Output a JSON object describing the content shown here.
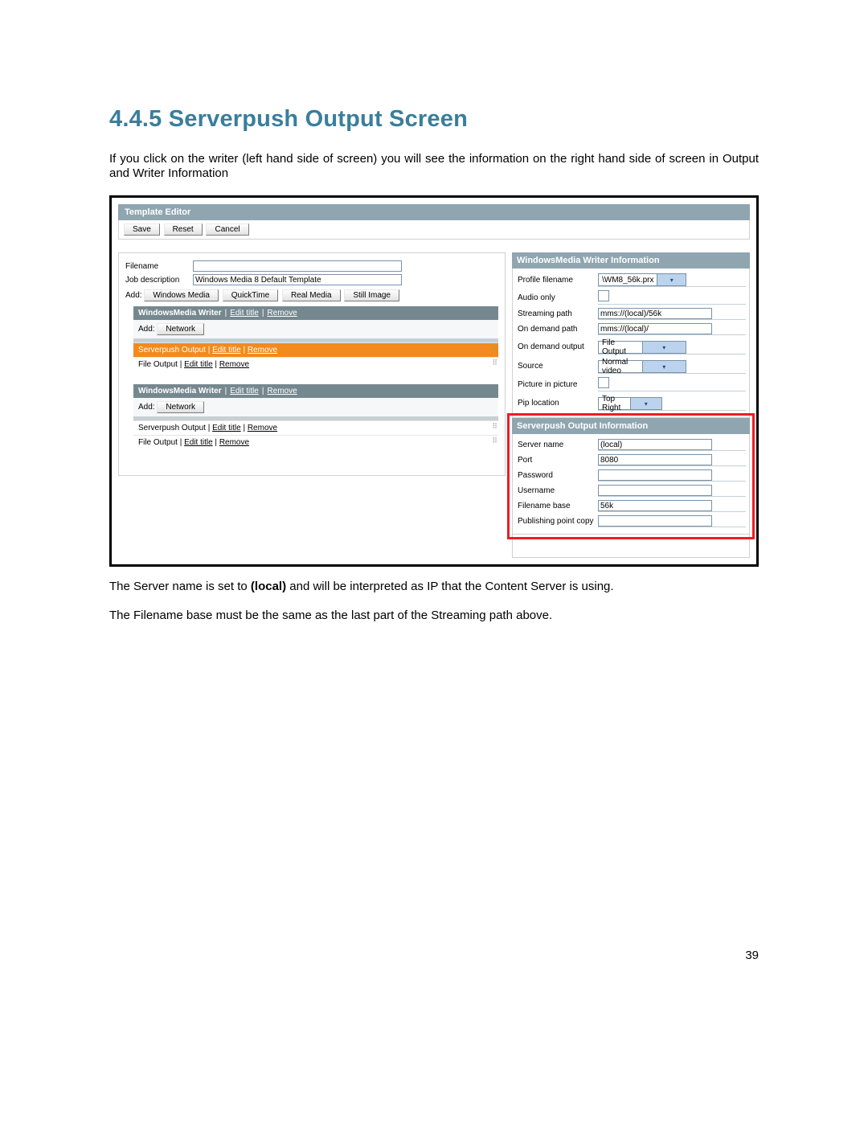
{
  "heading": "4.4.5   Serverpush Output Screen",
  "intro": "If you click on the writer (left hand side of screen) you will see the information on the right hand side of screen in Output and Writer Information",
  "post1_a": "The Server name is set to ",
  "post1_bold": "(local)",
  "post1_b": " and will be interpreted as IP that the Content Server is using.",
  "post2": "The Filename base must be the same as the last part of the Streaming path above.",
  "page_num": "39",
  "editor": {
    "title": "Template Editor",
    "buttons": {
      "save": "Save",
      "reset": "Reset",
      "cancel": "Cancel"
    },
    "left": {
      "filename_label": "Filename",
      "filename_value": "",
      "jobdesc_label": "Job description",
      "jobdesc_value": "Windows Media 8 Default Template",
      "add_label": "Add:",
      "add_buttons": {
        "wm": "Windows Media",
        "qt": "QuickTime",
        "rm": "Real Media",
        "si": "Still Image"
      },
      "writer_header": "WindowsMedia Writer",
      "edit_title": "Edit title",
      "remove": "Remove",
      "tree_add_label": "Add:",
      "tree_add_btn": "Network",
      "item_serverpush": "Serverpush Output",
      "item_fileout": "File Output"
    },
    "writer_info": {
      "header": "WindowsMedia Writer Information",
      "rows": {
        "profile_filename": {
          "label": "Profile filename",
          "value": "\\WM8_56k.prx"
        },
        "audio_only": {
          "label": "Audio only"
        },
        "streaming_path": {
          "label": "Streaming path",
          "value": "mms://(local)/56k"
        },
        "on_demand_path": {
          "label": "On demand path",
          "value": "mms://(local)/"
        },
        "on_demand_output": {
          "label": "On demand output",
          "value": "File Output"
        },
        "source": {
          "label": "Source",
          "value": "Normal video"
        },
        "pip": {
          "label": "Picture in picture"
        },
        "pip_location": {
          "label": "Pip location",
          "value": "Top Right"
        }
      }
    },
    "sp_info": {
      "header": "Serverpush Output Information",
      "rows": {
        "server_name": {
          "label": "Server name",
          "value": "(local)"
        },
        "port": {
          "label": "Port",
          "value": "8080"
        },
        "password": {
          "label": "Password",
          "value": ""
        },
        "username": {
          "label": "Username",
          "value": ""
        },
        "filename_base": {
          "label": "Filename base",
          "value": "56k"
        },
        "pubpoint": {
          "label": "Publishing point copy",
          "value": ""
        }
      }
    }
  }
}
